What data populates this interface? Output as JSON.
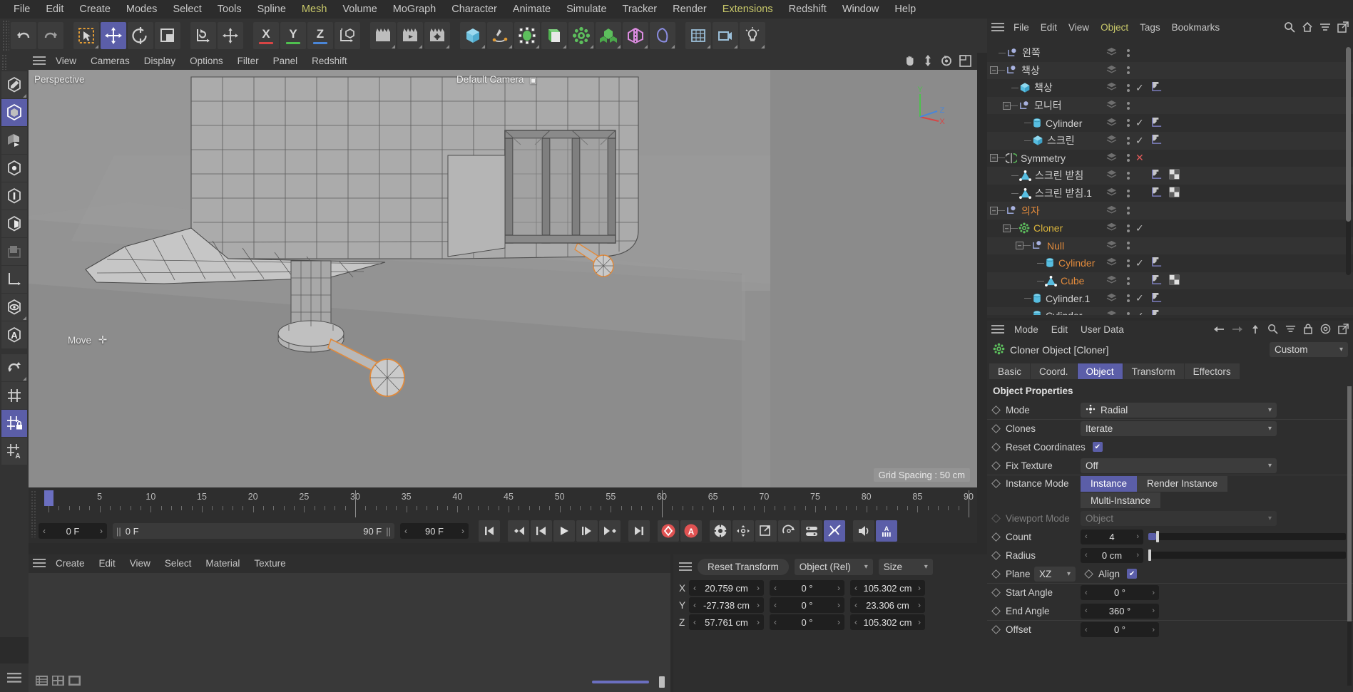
{
  "menubar": {
    "items": [
      {
        "label": "File",
        "hl": false
      },
      {
        "label": "Edit",
        "hl": false
      },
      {
        "label": "Create",
        "hl": false
      },
      {
        "label": "Modes",
        "hl": false
      },
      {
        "label": "Select",
        "hl": false
      },
      {
        "label": "Tools",
        "hl": false
      },
      {
        "label": "Spline",
        "hl": false
      },
      {
        "label": "Mesh",
        "hl": true
      },
      {
        "label": "Volume",
        "hl": false
      },
      {
        "label": "MoGraph",
        "hl": false
      },
      {
        "label": "Character",
        "hl": false
      },
      {
        "label": "Animate",
        "hl": false
      },
      {
        "label": "Simulate",
        "hl": false
      },
      {
        "label": "Tracker",
        "hl": false
      },
      {
        "label": "Render",
        "hl": false
      },
      {
        "label": "Extensions",
        "hl": true
      },
      {
        "label": "Redshift",
        "hl": false
      },
      {
        "label": "Window",
        "hl": false
      },
      {
        "label": "Help",
        "hl": false
      }
    ]
  },
  "toolbar": {
    "undo": "undo-icon",
    "redo": "redo-icon",
    "axis_x": "X",
    "axis_y": "Y",
    "axis_z": "Z",
    "colors": {
      "x": "#d84545",
      "y": "#4fc04f",
      "z": "#4a86d8"
    }
  },
  "viewport": {
    "menu": [
      "View",
      "Cameras",
      "Display",
      "Options",
      "Filter",
      "Panel",
      "Redshift"
    ],
    "projection_label": "Perspective",
    "camera_label": "Default Camera",
    "tool_label": "Move",
    "grid_spacing": "Grid Spacing : 50 cm",
    "axis": {
      "x": "X",
      "y": "Y",
      "z": "Z"
    }
  },
  "timeline": {
    "ticks": [
      "0",
      "5",
      "10",
      "15",
      "20",
      "25",
      "30",
      "35",
      "40",
      "45",
      "50",
      "55",
      "60",
      "65",
      "70",
      "75",
      "80",
      "85",
      "90"
    ],
    "current_frame": "0 F",
    "range_start": "0 F",
    "range_end": "90 F",
    "preview_end": "90 F",
    "end_frame_field": "0 F"
  },
  "material_manager": {
    "menu": [
      "Create",
      "Edit",
      "View",
      "Select",
      "Material",
      "Texture"
    ]
  },
  "coordinates": {
    "reset_label": "Reset Transform",
    "mode": "Object (Rel)",
    "size_mode": "Size",
    "rows": [
      {
        "axis": "X",
        "position": "20.759 cm",
        "rotation": "0 °",
        "size": "105.302 cm"
      },
      {
        "axis": "Y",
        "position": "-27.738 cm",
        "rotation": "0 °",
        "size": "23.306 cm"
      },
      {
        "axis": "Z",
        "position": "57.761 cm",
        "rotation": "0 °",
        "size": "105.302 cm"
      }
    ]
  },
  "object_manager": {
    "menu": [
      {
        "label": "File",
        "hl": false
      },
      {
        "label": "Edit",
        "hl": false
      },
      {
        "label": "View",
        "hl": false
      },
      {
        "label": "Object",
        "hl": true
      },
      {
        "label": "Tags",
        "hl": false
      },
      {
        "label": "Bookmarks",
        "hl": false
      }
    ],
    "items": [
      {
        "name": "왼쪽",
        "indent": 0,
        "icon": "null",
        "exp": "",
        "color": "normal",
        "check": "",
        "tags": []
      },
      {
        "name": "책상",
        "indent": 0,
        "icon": "null",
        "exp": "-",
        "color": "normal",
        "check": "",
        "tags": []
      },
      {
        "name": "책상",
        "indent": 1,
        "icon": "cube",
        "exp": "",
        "color": "normal",
        "check": "check",
        "tags": [
          "material"
        ]
      },
      {
        "name": "모니터",
        "indent": 1,
        "icon": "null",
        "exp": "-",
        "color": "normal",
        "check": "",
        "tags": []
      },
      {
        "name": "Cylinder",
        "indent": 2,
        "icon": "cylinder",
        "exp": "",
        "color": "normal",
        "check": "check",
        "tags": [
          "material"
        ]
      },
      {
        "name": "스크린",
        "indent": 2,
        "icon": "cube",
        "exp": "",
        "color": "normal",
        "check": "check",
        "tags": [
          "material"
        ]
      },
      {
        "name": "Symmetry",
        "indent": 0,
        "icon": "symmetry",
        "exp": "-",
        "color": "normal",
        "check": "x",
        "tags": []
      },
      {
        "name": "스크린 받침",
        "indent": 1,
        "icon": "poly",
        "exp": "",
        "color": "normal",
        "check": "",
        "tags": [
          "material",
          "uv"
        ]
      },
      {
        "name": "스크린 받침.1",
        "indent": 1,
        "icon": "poly",
        "exp": "",
        "color": "normal",
        "check": "",
        "tags": [
          "material",
          "uv"
        ]
      },
      {
        "name": "의자",
        "indent": 0,
        "icon": "null",
        "exp": "-",
        "color": "sel",
        "check": "",
        "tags": []
      },
      {
        "name": "Cloner",
        "indent": 1,
        "icon": "cloner",
        "exp": "-",
        "color": "yel",
        "check": "check",
        "tags": []
      },
      {
        "name": "Null",
        "indent": 2,
        "icon": "null",
        "exp": "-",
        "color": "sel",
        "check": "",
        "tags": []
      },
      {
        "name": "Cylinder",
        "indent": 3,
        "icon": "cylinder",
        "exp": "",
        "color": "sel",
        "check": "check",
        "tags": [
          "material"
        ]
      },
      {
        "name": "Cube",
        "indent": 3,
        "icon": "poly",
        "exp": "",
        "color": "sel",
        "check": "",
        "tags": [
          "material",
          "uv"
        ]
      },
      {
        "name": "Cylinder.1",
        "indent": 2,
        "icon": "cylinder",
        "exp": "",
        "color": "normal",
        "check": "check",
        "tags": [
          "material"
        ]
      },
      {
        "name": "Cylinder",
        "indent": 2,
        "icon": "cylinder",
        "exp": "",
        "color": "normal",
        "check": "check",
        "tags": [
          "material"
        ]
      }
    ]
  },
  "attribute_manager": {
    "menu": [
      "Mode",
      "Edit",
      "User Data"
    ],
    "object_title": "Cloner Object [Cloner]",
    "preset": "Custom",
    "tabs": [
      {
        "label": "Basic",
        "on": false
      },
      {
        "label": "Coord.",
        "on": false
      },
      {
        "label": "Object",
        "on": true
      },
      {
        "label": "Transform",
        "on": false
      },
      {
        "label": "Effectors",
        "on": false
      }
    ],
    "section_title": "Object Properties",
    "props": {
      "mode_label": "Mode",
      "mode_value": "Radial",
      "clones_label": "Clones",
      "clones_value": "Iterate",
      "reset_coords_label": "Reset Coordinates",
      "reset_coords_checked": true,
      "fix_texture_label": "Fix Texture",
      "fix_texture_value": "Off",
      "instance_mode_label": "Instance Mode",
      "instance_seg1": "Instance",
      "instance_seg2": "Render Instance",
      "instance_seg3": "Multi-Instance",
      "viewport_mode_label": "Viewport Mode",
      "viewport_mode_value": "Object",
      "count_label": "Count",
      "count_value": "4",
      "radius_label": "Radius",
      "radius_value": "0 cm",
      "plane_label": "Plane",
      "plane_value": "XZ",
      "align_label": "Align",
      "align_checked": true,
      "start_angle_label": "Start Angle",
      "start_angle_value": "0 °",
      "end_angle_label": "End Angle",
      "end_angle_value": "360 °",
      "offset_label": "Offset",
      "offset_value": "0 °"
    }
  },
  "theme": {
    "accent": "#5b5ea8",
    "selected_text": "#e08a3c",
    "highlight_menu": "#c9c96a",
    "panel_bg": "#2e2e2e",
    "toolbar_bg": "#333333"
  }
}
